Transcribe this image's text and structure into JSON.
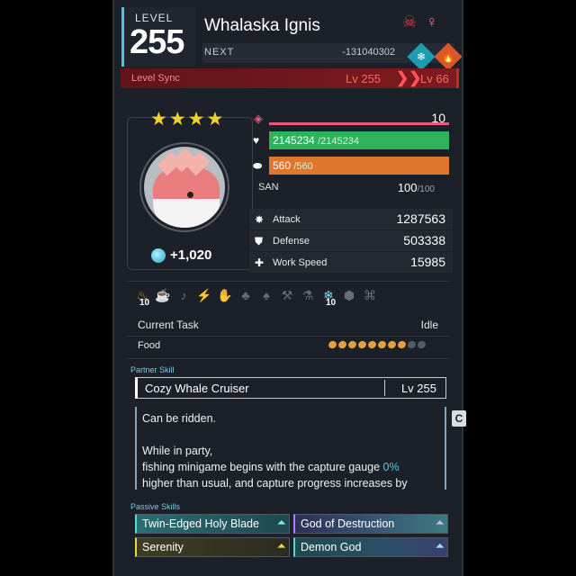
{
  "header": {
    "level_label": "LEVEL",
    "level": "255",
    "name": "Whalaska Ignis",
    "next_label": "NEXT",
    "next_value": "-131040302",
    "partner_icon": "horned-mask-icon",
    "gender_icon": "female-icon",
    "elements": [
      {
        "name": "ice-element-icon",
        "glyph": "❄",
        "color": "#1f9db0"
      },
      {
        "name": "fire-element-icon",
        "glyph": "🔥",
        "color": "#d7582b"
      }
    ]
  },
  "level_sync": {
    "label": "Level Sync",
    "from": "Lv 255",
    "to": "Lv 66"
  },
  "rarity_stars": "★★★★",
  "soul": {
    "value": "+1,020"
  },
  "rank": {
    "value": "10"
  },
  "hp": {
    "value": "2145234",
    "max": "/2145234",
    "fill": 1.0
  },
  "stamina": {
    "value": "560",
    "max": "/560",
    "fill": 1.0
  },
  "san": {
    "label": "SAN",
    "value": "100",
    "max": "/100"
  },
  "stats": [
    {
      "label": "Attack",
      "value": "1287563",
      "icon": "sword-burst-icon"
    },
    {
      "label": "Defense",
      "value": "503338",
      "icon": "shield-icon"
    },
    {
      "label": "Work Speed",
      "value": "15985",
      "icon": "work-speed-icon"
    }
  ],
  "work_suitability": [
    {
      "icon": "kindling-icon",
      "glyph": "♨",
      "active": true,
      "level": "10"
    },
    {
      "icon": "watering-icon",
      "glyph": "☕",
      "active": false,
      "level": ""
    },
    {
      "icon": "planting-icon",
      "glyph": "♪",
      "active": false,
      "level": ""
    },
    {
      "icon": "electricity-icon",
      "glyph": "⚡",
      "active": false,
      "level": ""
    },
    {
      "icon": "handiwork-icon",
      "glyph": "✋",
      "active": false,
      "level": ""
    },
    {
      "icon": "gathering-icon",
      "glyph": "♣",
      "active": false,
      "level": ""
    },
    {
      "icon": "lumbering-icon",
      "glyph": "♠",
      "active": false,
      "level": ""
    },
    {
      "icon": "mining-icon",
      "glyph": "⚒",
      "active": false,
      "level": ""
    },
    {
      "icon": "medicine-icon",
      "glyph": "⚗",
      "active": false,
      "level": ""
    },
    {
      "icon": "cooling-icon",
      "glyph": "❄",
      "active": true,
      "level": "10"
    },
    {
      "icon": "transporting-icon",
      "glyph": "⬢",
      "active": false,
      "level": ""
    },
    {
      "icon": "farming-icon",
      "glyph": "⌘",
      "active": false,
      "level": ""
    }
  ],
  "task": {
    "label": "Current Task",
    "value": "Idle"
  },
  "food": {
    "label": "Food",
    "filled": 8,
    "total": 10
  },
  "partner_skill": {
    "section_title": "Partner Skill",
    "name": "Cozy Whale Cruiser",
    "level": "Lv  255",
    "desc_line1": "Can be ridden.",
    "desc_line2": "While in party,",
    "desc_line3a": "fishing minigame begins with the capture gauge ",
    "desc_line3_highlight": "0%",
    "desc_line4": "higher than usual, and capture progress increases by"
  },
  "side_tab": "C",
  "passive_skills": {
    "section_title": "Passive Skills",
    "items": [
      {
        "label": "Twin-Edged Holy Blade",
        "style": "p-cyan"
      },
      {
        "label": "God of Destruction",
        "style": "p-rainbow"
      },
      {
        "label": "Serenity",
        "style": "p-yellow"
      },
      {
        "label": "Demon God",
        "style": "p-rainbow2"
      }
    ]
  }
}
